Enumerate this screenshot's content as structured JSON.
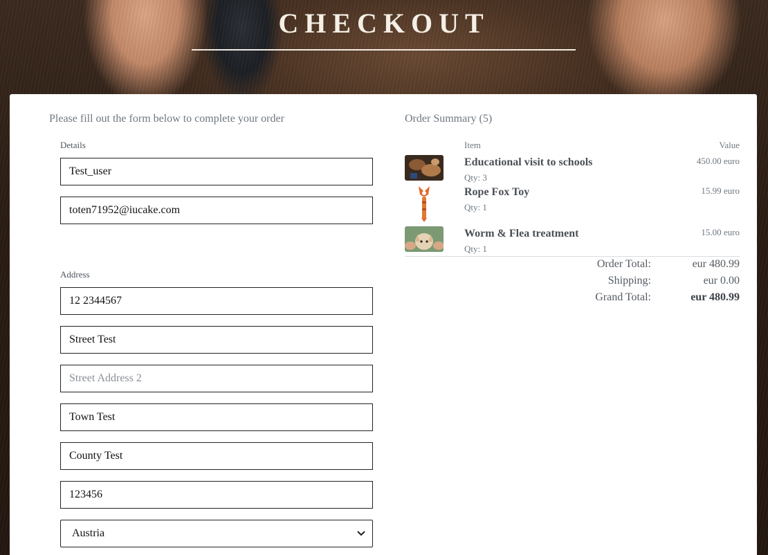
{
  "header": {
    "title": "CHECKOUT"
  },
  "form": {
    "intro": "Please fill out the form below to complete your order",
    "details_label": "Details",
    "full_name": "Test_user",
    "email": "toten71952@iucake.com",
    "address_label": "Address",
    "phone": "12 2344567",
    "street1": "Street Test",
    "street2_placeholder": "Street Address 2",
    "town": "Town Test",
    "county": "County Test",
    "postcode": "123456",
    "country": "Austria"
  },
  "summary": {
    "title": "Order Summary (5)",
    "col_item": "Item",
    "col_value": "Value",
    "items": [
      {
        "name": "Educational visit to schools",
        "qty": "Qty: 3",
        "price": "450.00 euro"
      },
      {
        "name": "Rope Fox Toy",
        "qty": "Qty: 1",
        "price": "15.99 euro"
      },
      {
        "name": "Worm & Flea treatment",
        "qty": "Qty: 1",
        "price": "15.00 euro"
      }
    ],
    "order_total_label": "Order Total:",
    "order_total": "eur 480.99",
    "shipping_label": "Shipping:",
    "shipping": "eur 0.00",
    "grand_total_label": "Grand Total:",
    "grand_total": "eur 480.99"
  }
}
